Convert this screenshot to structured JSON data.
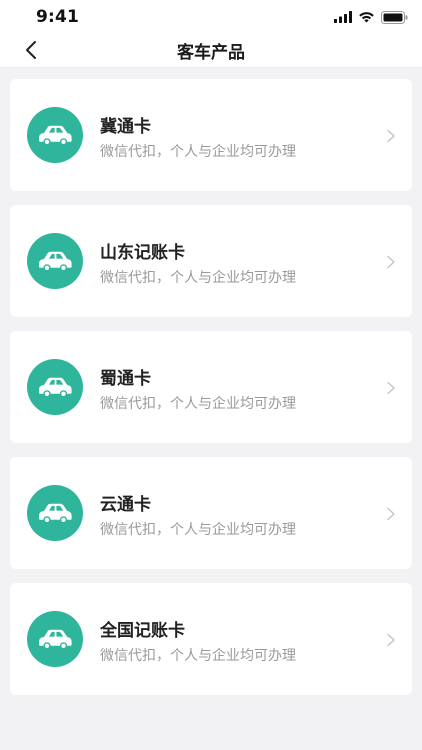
{
  "status_bar": {
    "time": "9:41",
    "icons": [
      "signal-icon",
      "wifi-icon",
      "battery-icon"
    ]
  },
  "nav": {
    "title": "客车产品",
    "back_icon": "chevron-left-icon"
  },
  "products": [
    {
      "title": "冀通卡",
      "subtitle": "微信代扣，个人与企业均可办理"
    },
    {
      "title": "山东记账卡",
      "subtitle": "微信代扣，个人与企业均可办理"
    },
    {
      "title": "蜀通卡",
      "subtitle": "微信代扣，个人与企业均可办理"
    },
    {
      "title": "云通卡",
      "subtitle": "微信代扣，个人与企业均可办理"
    },
    {
      "title": "全国记账卡",
      "subtitle": "微信代扣，个人与企业均可办理"
    }
  ],
  "card_icon": "car-icon",
  "colors": {
    "accent": "#2fb59c",
    "background": "#f2f2f4",
    "card": "#ffffff",
    "subtitle": "#9a9a9a",
    "chevron": "#c4c4c4"
  }
}
